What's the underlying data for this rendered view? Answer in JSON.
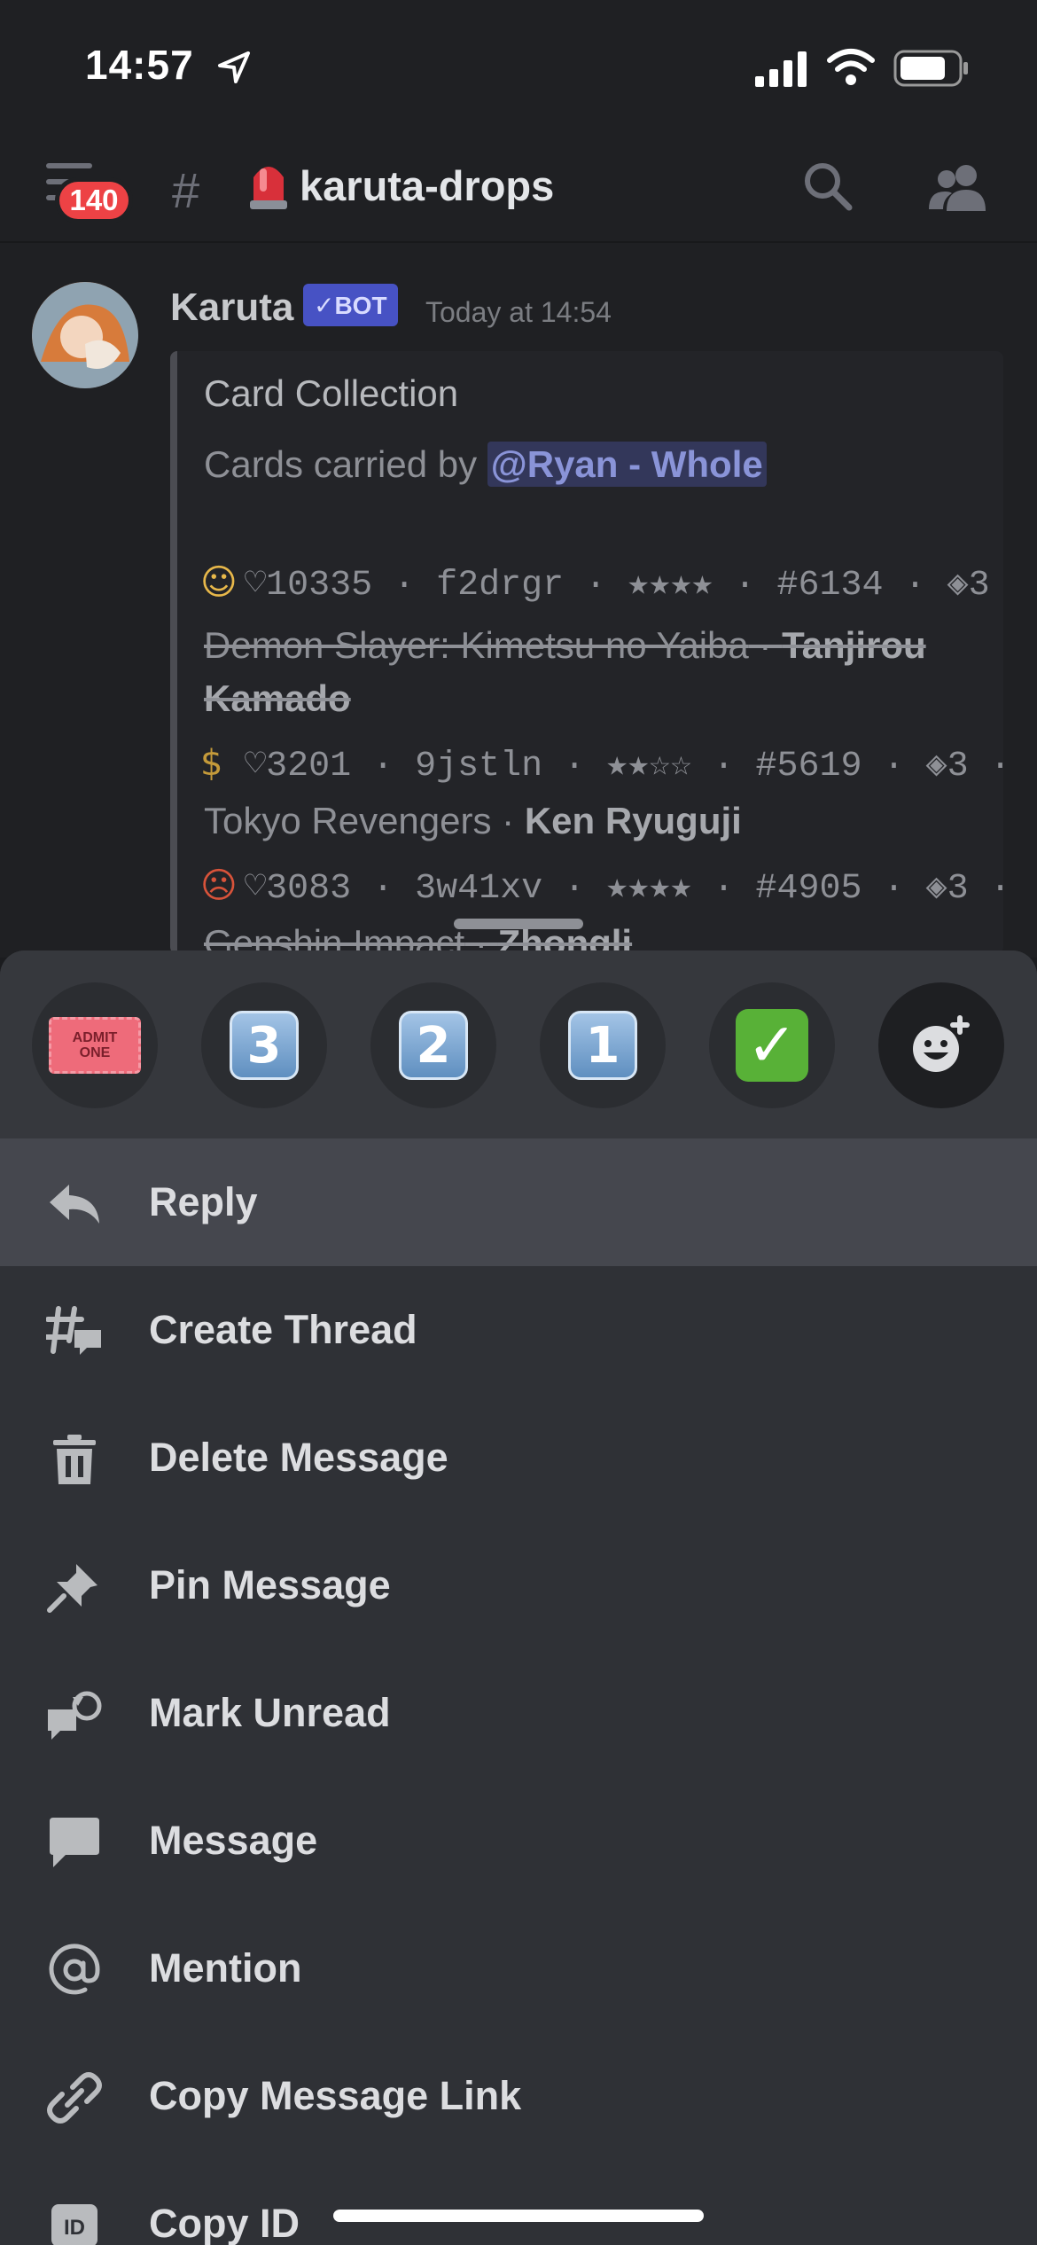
{
  "status_bar": {
    "time": "14:57"
  },
  "header": {
    "badge_count": "140",
    "channel_name": "karuta-drops"
  },
  "message": {
    "author": "Karuta",
    "bot_tag": "✓BOT",
    "timestamp": "Today at 14:54",
    "embed": {
      "title": "Card Collection",
      "desc_prefix": "Cards carried by ",
      "mention": "@Ryan - Whole",
      "cards": [
        {
          "emoji": "☺",
          "line": "♡10335 · f2drgr · ★★★★ · #6134  · ◈3 ·",
          "series": "Demon Slayer: Kimetsu no Yaiba",
          "character": "Tanjirou",
          "character_cont": "Kamado"
        },
        {
          "emoji": "$",
          "line": "♡3201  · 9jstln · ★★☆☆ · #5619  · ◈3 ·",
          "series": "Tokyo Revengers",
          "character": "Ken Ryuguji"
        },
        {
          "emoji": "☹",
          "line": "♡3083  · 3w41xv · ★★★★ · #4905  · ◈3 ·",
          "series": "Genshin Impact",
          "character": "Zhongli"
        }
      ]
    }
  },
  "reactions": [
    {
      "name": "admit-one-ticket",
      "line1": "ADMIT",
      "line2": "ONE"
    },
    {
      "name": "keycap-3",
      "label": "3"
    },
    {
      "name": "keycap-2",
      "label": "2"
    },
    {
      "name": "keycap-1",
      "label": "1"
    },
    {
      "name": "check-mark",
      "label": "✓"
    }
  ],
  "menu": [
    {
      "label": "Reply",
      "icon": "reply-icon"
    },
    {
      "label": "Create Thread",
      "icon": "thread-icon"
    },
    {
      "label": "Delete Message",
      "icon": "trash-icon"
    },
    {
      "label": "Pin Message",
      "icon": "pin-icon"
    },
    {
      "label": "Mark Unread",
      "icon": "mark-unread-icon"
    },
    {
      "label": "Message",
      "icon": "message-icon"
    },
    {
      "label": "Mention",
      "icon": "at-icon"
    },
    {
      "label": "Copy Message Link",
      "icon": "link-icon"
    },
    {
      "label": "Copy ID",
      "icon": "id-icon"
    }
  ],
  "colors": {
    "accent": "#ed4245",
    "bot_tag": "#4752c4",
    "sheet": "#2f3136",
    "active_row": "#45474e"
  }
}
